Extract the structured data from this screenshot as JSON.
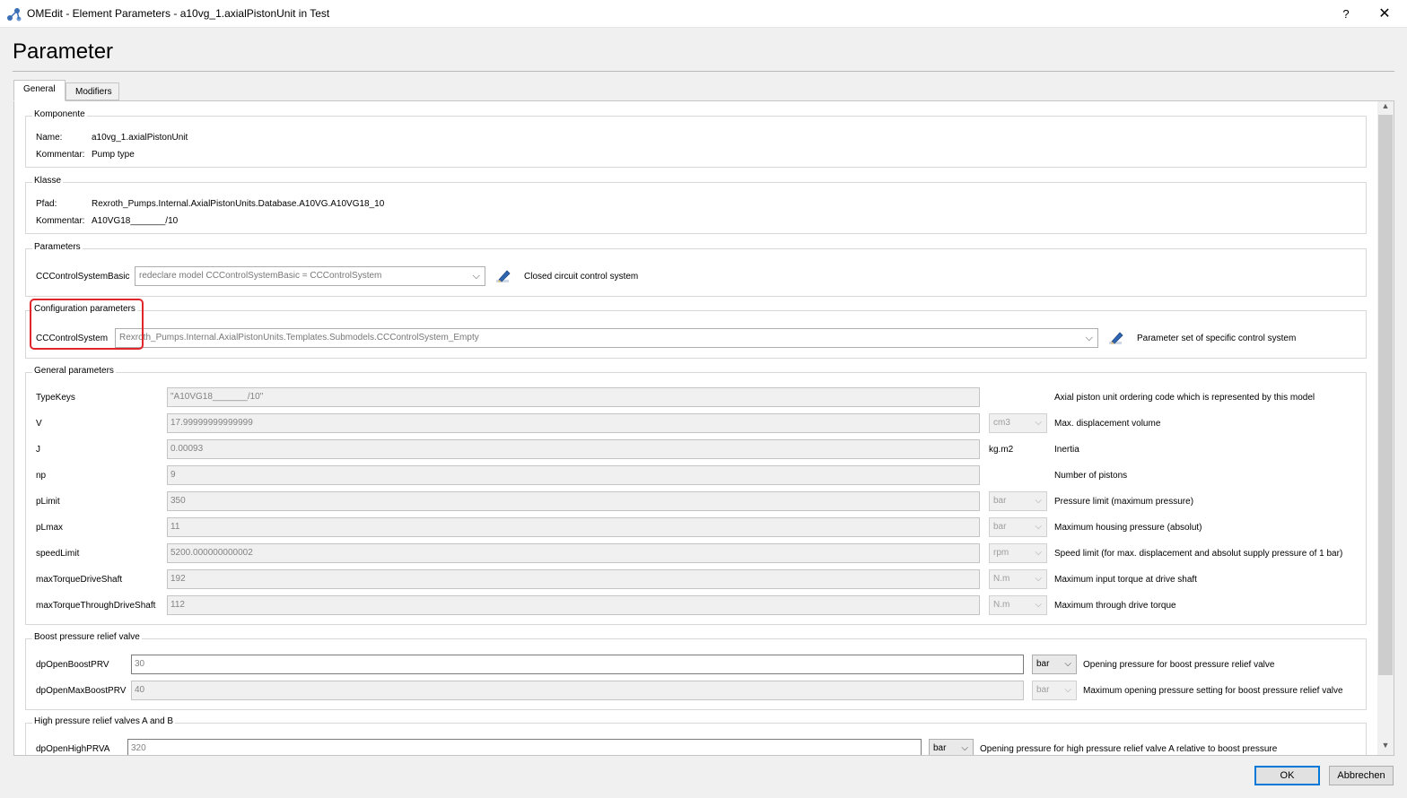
{
  "window": {
    "title": "OMEdit - Element Parameters - a10vg_1.axialPistonUnit in Test",
    "help": "?",
    "close": "✕"
  },
  "heading": "Parameter",
  "tabs": [
    {
      "label": "General"
    },
    {
      "label": "Modifiers"
    }
  ],
  "komponente": {
    "title": "Komponente",
    "name_label": "Name:",
    "name_value": "a10vg_1.axialPistonUnit",
    "comment_label": "Kommentar:",
    "comment_value": "Pump type"
  },
  "klasse": {
    "title": "Klasse",
    "path_label": "Pfad:",
    "path_value": "Rexroth_Pumps.Internal.AxialPistonUnits.Database.A10VG.A10VG18_10",
    "comment_label": "Kommentar:",
    "comment_value": "A10VG18_______/10"
  },
  "parameters": {
    "title": "Parameters",
    "label": "CCControlSystemBasic",
    "value": "redeclare model CCControlSystemBasic = CCControlSystem",
    "description": "Closed circuit control system"
  },
  "config": {
    "title": "Configuration parameters",
    "label": "CCControlSystem",
    "value": "Rexroth_Pumps.Internal.AxialPistonUnits.Templates.Submodels.CCControlSystem_Empty",
    "description": "Parameter set of specific control system"
  },
  "general": {
    "title": "General parameters",
    "rows": [
      {
        "label": "TypeKeys",
        "value": "\"A10VG18_______/10\"",
        "unit": "",
        "desc": "Axial piston unit ordering code which is represented by this model"
      },
      {
        "label": "V",
        "value": "17.99999999999999",
        "unit": "cm3",
        "desc": "Max. displacement volume"
      },
      {
        "label": "J",
        "value": "0.00093",
        "unit": "kg.m2",
        "desc": "Inertia"
      },
      {
        "label": "np",
        "value": "9",
        "unit": "",
        "desc": "Number of pistons"
      },
      {
        "label": "pLimit",
        "value": "350",
        "unit": "bar",
        "desc": "Pressure limit (maximum pressure)"
      },
      {
        "label": "pLmax",
        "value": "11",
        "unit": "bar",
        "desc": "Maximum housing pressure (absolut)"
      },
      {
        "label": "speedLimit",
        "value": "5200.000000000002",
        "unit": "rpm",
        "desc": "Speed limit (for max. displacement and absolut supply pressure of 1 bar)"
      },
      {
        "label": "maxTorqueDriveShaft",
        "value": "192",
        "unit": "N.m",
        "desc": "Maximum input torque at drive shaft"
      },
      {
        "label": "maxTorqueThroughDriveShaft",
        "value": "112",
        "unit": "N.m",
        "desc": "Maximum through drive torque"
      }
    ]
  },
  "boost": {
    "title": "Boost pressure relief valve",
    "rows": [
      {
        "label": "dpOpenBoostPRV",
        "value": "30",
        "unit": "bar",
        "desc": "Opening pressure for boost pressure relief valve"
      },
      {
        "label": "dpOpenMaxBoostPRV",
        "value": "40",
        "unit": "bar",
        "desc": "Maximum opening pressure setting for boost pressure relief valve"
      }
    ]
  },
  "highpressure": {
    "title": "High pressure relief valves A and B",
    "rows": [
      {
        "label": "dpOpenHighPRVA",
        "value": "320",
        "unit": "bar",
        "desc": "Opening pressure for high pressure relief valve A relative to boost pressure"
      }
    ]
  },
  "buttons": {
    "ok": "OK",
    "cancel": "Abbrechen"
  },
  "icons": {
    "app": "omedit-logo-icon",
    "edit": "pencil-edit-icon",
    "dropdown": "chevron-down-icon"
  },
  "colors": {
    "highlight": "#e0262b",
    "accent": "#0078d7"
  }
}
